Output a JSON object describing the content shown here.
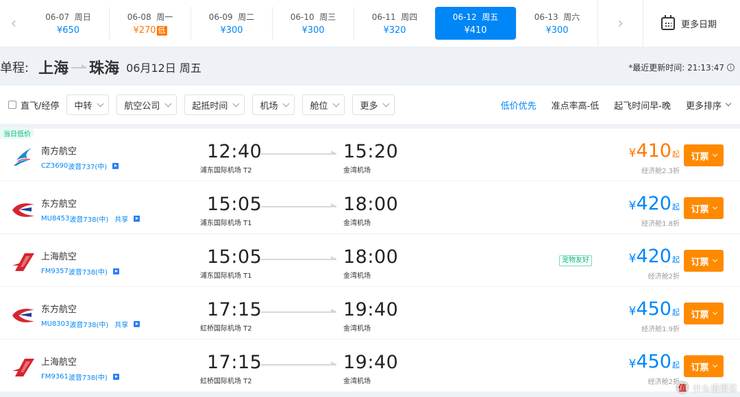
{
  "dates": [
    {
      "date": "06-07",
      "weekday": "周日",
      "price": "¥650",
      "low": "",
      "active": false
    },
    {
      "date": "06-08",
      "weekday": "周一",
      "price": "¥270",
      "low": "低",
      "active": false
    },
    {
      "date": "06-09",
      "weekday": "周二",
      "price": "¥300",
      "low": "",
      "active": false
    },
    {
      "date": "06-10",
      "weekday": "周三",
      "price": "¥300",
      "low": "",
      "active": false
    },
    {
      "date": "06-11",
      "weekday": "周四",
      "price": "¥320",
      "low": "",
      "active": false
    },
    {
      "date": "06-12",
      "weekday": "周五",
      "price": "¥410",
      "low": "",
      "active": true
    },
    {
      "date": "06-13",
      "weekday": "周六",
      "price": "¥300",
      "low": "",
      "active": false
    }
  ],
  "more_dates_label": "更多日期",
  "route": {
    "trip_type": "单程:",
    "from": "上海",
    "to": "珠海",
    "date_text": "06月12日 周五",
    "update_time": "*最近更新时间: 21:13:47",
    "info_icon": "i"
  },
  "filters": {
    "direct_label": "直飞/经停",
    "dropdowns": [
      "中转",
      "航空公司",
      "起抵时间",
      "机场",
      "舱位",
      "更多"
    ],
    "sorts": [
      "低价优先",
      "准点率高-低",
      "起飞时间早-晚",
      "更多排序"
    ]
  },
  "flights": [
    {
      "badge": "当日低价",
      "airline": "南方航空",
      "code": "CZ3690",
      "aircraft": "波音737(中)",
      "share": "",
      "dep_time": "12:40",
      "dep_airport": "浦东国际机场 T2",
      "arr_time": "15:20",
      "arr_airport": "金湾机场",
      "tag": "",
      "currency": "¥",
      "price": "410",
      "qi": "起",
      "cabin": "经济舱2.3折",
      "price_color": "orange",
      "book": "订票",
      "logo": "china-southern"
    },
    {
      "badge": "",
      "airline": "东方航空",
      "code": "MU8453",
      "aircraft": "波音738(中)",
      "share": "共享",
      "dep_time": "15:05",
      "dep_airport": "浦东国际机场 T1",
      "arr_time": "18:00",
      "arr_airport": "金湾机场",
      "tag": "",
      "currency": "¥",
      "price": "420",
      "qi": "起",
      "cabin": "经济舱1.8折",
      "price_color": "blue",
      "book": "订票",
      "logo": "china-eastern"
    },
    {
      "badge": "",
      "airline": "上海航空",
      "code": "FM9357",
      "aircraft": "波音738(中)",
      "share": "",
      "dep_time": "15:05",
      "dep_airport": "浦东国际机场 T1",
      "arr_time": "18:00",
      "arr_airport": "金湾机场",
      "tag": "宠物友好",
      "currency": "¥",
      "price": "420",
      "qi": "起",
      "cabin": "经济舱2折",
      "price_color": "blue",
      "book": "订票",
      "logo": "shanghai-airlines"
    },
    {
      "badge": "",
      "airline": "东方航空",
      "code": "MU8303",
      "aircraft": "波音738(中)",
      "share": "共享",
      "dep_time": "17:15",
      "dep_airport": "虹桥国际机场 T2",
      "arr_time": "19:40",
      "arr_airport": "金湾机场",
      "tag": "",
      "currency": "¥",
      "price": "450",
      "qi": "起",
      "cabin": "经济舱1.9折",
      "price_color": "blue",
      "book": "订票",
      "logo": "china-eastern"
    },
    {
      "badge": "",
      "airline": "上海航空",
      "code": "FM9361",
      "aircraft": "波音738(中)",
      "share": "",
      "dep_time": "17:15",
      "dep_airport": "虹桥国际机场 T2",
      "arr_time": "19:40",
      "arr_airport": "金湾机场",
      "tag": "",
      "currency": "¥",
      "price": "450",
      "qi": "起",
      "cabin": "经济舱2折",
      "price_color": "blue",
      "book": "订票",
      "logo": "shanghai-airlines"
    }
  ],
  "watermark": {
    "logo_text": "值",
    "text": "什么值得买"
  },
  "colors": {
    "accent": "#0086f6",
    "orange": "#ff7700",
    "book": "#ff8a00",
    "green": "#00b87a"
  }
}
